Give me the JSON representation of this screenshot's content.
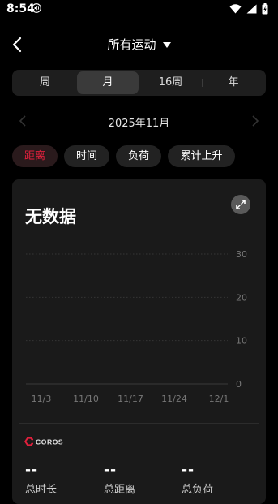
{
  "status": {
    "time": "8:54"
  },
  "header": {
    "title": "所有运动"
  },
  "segments": [
    {
      "label": "周"
    },
    {
      "label": "月"
    },
    {
      "label": "16周"
    },
    {
      "label": "年"
    }
  ],
  "active_segment": "月",
  "date": {
    "label": "2025年11月"
  },
  "chips": [
    {
      "label": "距离",
      "active": true
    },
    {
      "label": "时间"
    },
    {
      "label": "负荷"
    },
    {
      "label": "累计上升"
    }
  ],
  "card": {
    "no_data": "无数据",
    "logo_text": "COROS",
    "stats": [
      {
        "value": "--",
        "label": "总时长"
      },
      {
        "value": "--",
        "label": "总距离"
      },
      {
        "value": "--",
        "label": "总负荷"
      }
    ]
  },
  "colors": {
    "accent": "#e0203c",
    "background": "#000000",
    "card": "#1a1a1a"
  },
  "chart_data": {
    "type": "bar",
    "categories": [
      "11/3",
      "11/10",
      "11/17",
      "11/24",
      "12/1"
    ],
    "y_ticks": [
      "30",
      "20",
      "10",
      "0"
    ],
    "values": [],
    "ylim": [
      0,
      30
    ],
    "grid": true,
    "title": "",
    "xlabel": "",
    "ylabel": ""
  }
}
